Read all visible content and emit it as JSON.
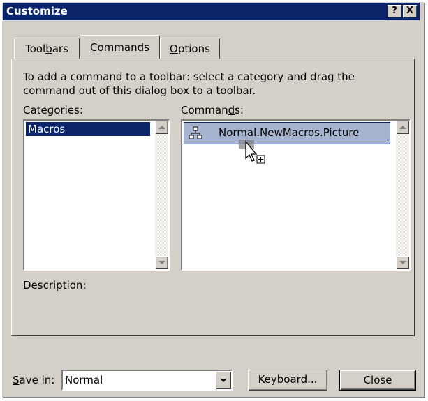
{
  "window": {
    "title": "Customize",
    "help_button": "?",
    "close_button": "X"
  },
  "tabs": [
    {
      "label": "Toolbars",
      "selected": false
    },
    {
      "label": "Commands",
      "selected": true
    },
    {
      "label": "Options",
      "selected": false
    }
  ],
  "instructions": "To add a command to a toolbar: select a category and drag the command out of this dialog box to a toolbar.",
  "categories": {
    "label": "Categories:",
    "items": [
      "Macros"
    ],
    "selected": "Macros"
  },
  "commands": {
    "label": "Commands:",
    "items": [
      "Normal.NewMacros.Picture"
    ],
    "selected": "Normal.NewMacros.Picture"
  },
  "description": {
    "label": "Description:",
    "text": ""
  },
  "save_in": {
    "label": "Save in:",
    "value": "Normal"
  },
  "buttons": {
    "keyboard": "Keyboard...",
    "close": "Close"
  },
  "colors": {
    "title_bar": "#0a246a",
    "selection": "#0a246a",
    "command_highlight": "#a6b3cf",
    "face": "#d4d0c8"
  },
  "icons": {
    "macro": "macro-icon",
    "cursor": "drag-copy-cursor-icon"
  }
}
